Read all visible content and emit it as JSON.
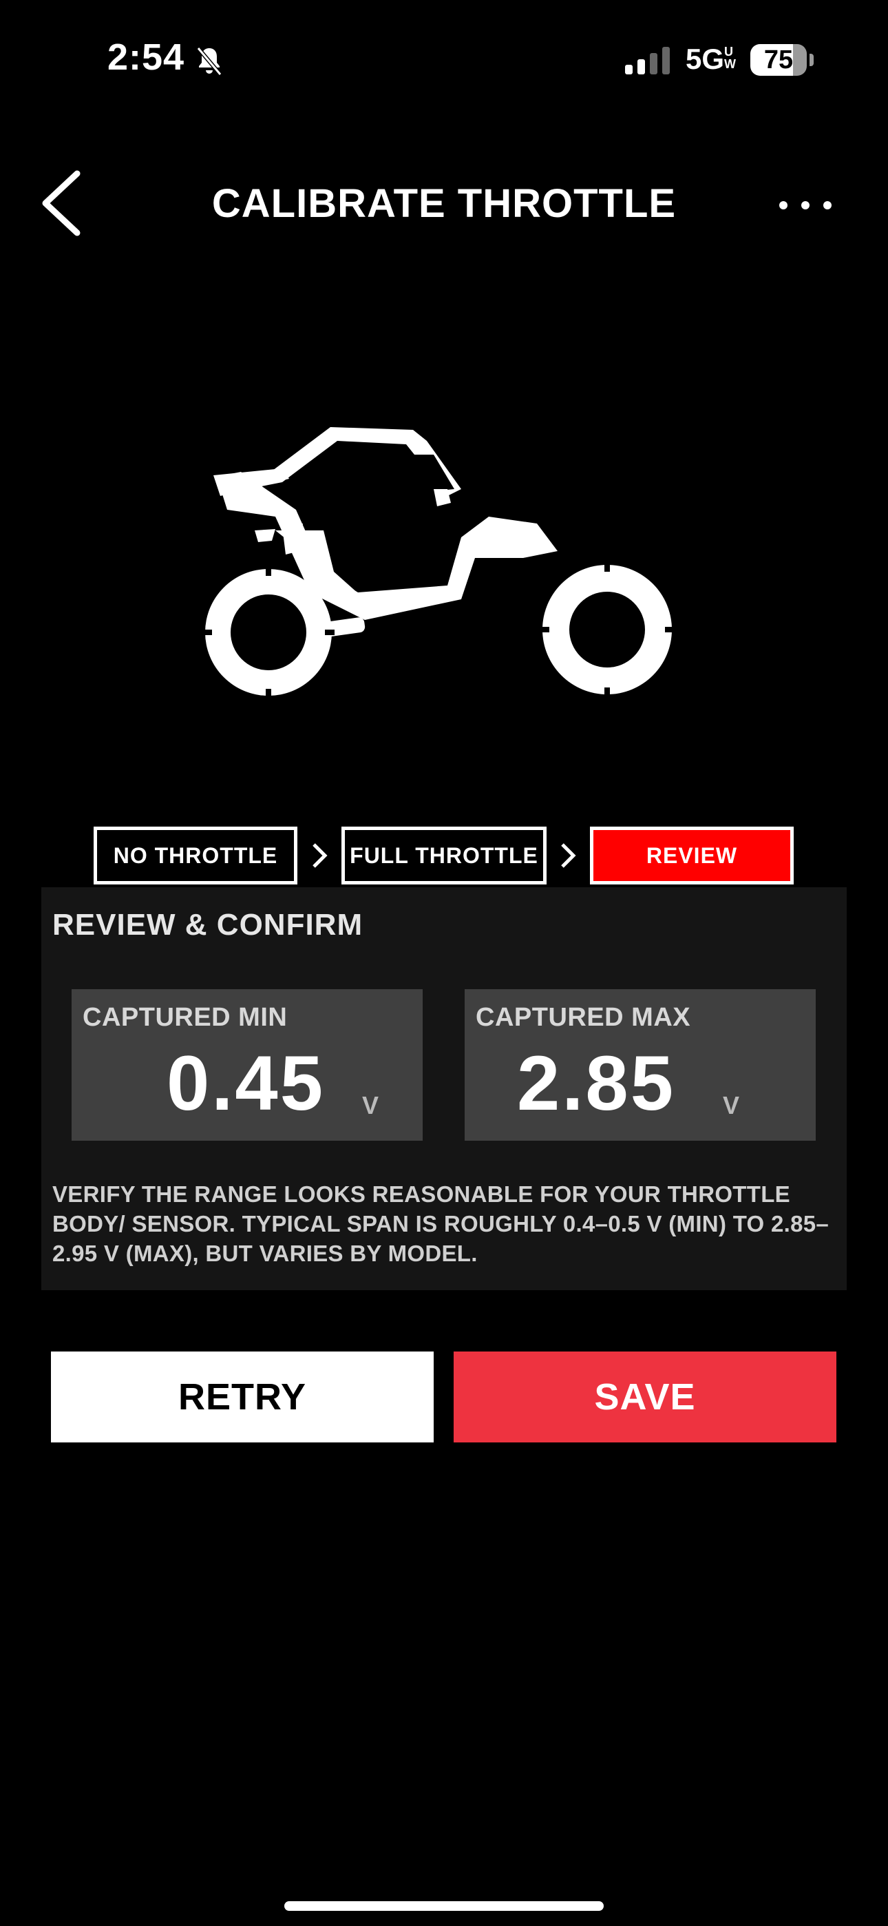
{
  "status_bar": {
    "time": "2:54",
    "network": "5G",
    "network_sup": "UW",
    "battery_level": "75",
    "battery_fraction": 0.75
  },
  "header": {
    "title": "CALIBRATE THROTTLE"
  },
  "steps": [
    {
      "label": "NO THROTTLE",
      "active": false
    },
    {
      "label": "FULL THROTTLE",
      "active": false
    },
    {
      "label": "REVIEW",
      "active": true
    }
  ],
  "review": {
    "title": "REVIEW & CONFIRM",
    "captured_min": {
      "label": "CAPTURED MIN",
      "value": "0.45",
      "unit": "V"
    },
    "captured_max": {
      "label": "CAPTURED MAX",
      "value": "2.85",
      "unit": "V"
    },
    "note": "VERIFY THE RANGE LOOKS REASONABLE FOR YOUR THROTTLE BODY/ SENSOR. TYPICAL SPAN IS ROUGHLY 0.4–0.5 V (MIN) TO 2.85–2.95 V (MAX), BUT VARIES BY MODEL."
  },
  "actions": {
    "retry_label": "RETRY",
    "save_label": "SAVE"
  },
  "colors": {
    "accent_red": "#ff0000",
    "save_red": "#ee3340",
    "panel_bg": "#151515",
    "card_bg": "#404040"
  },
  "icons": {
    "back": "chevron-left-icon",
    "more": "more-horizontal-icon",
    "bell": "bell-muted-icon",
    "vehicle": "utv-side-by-side-icon"
  }
}
